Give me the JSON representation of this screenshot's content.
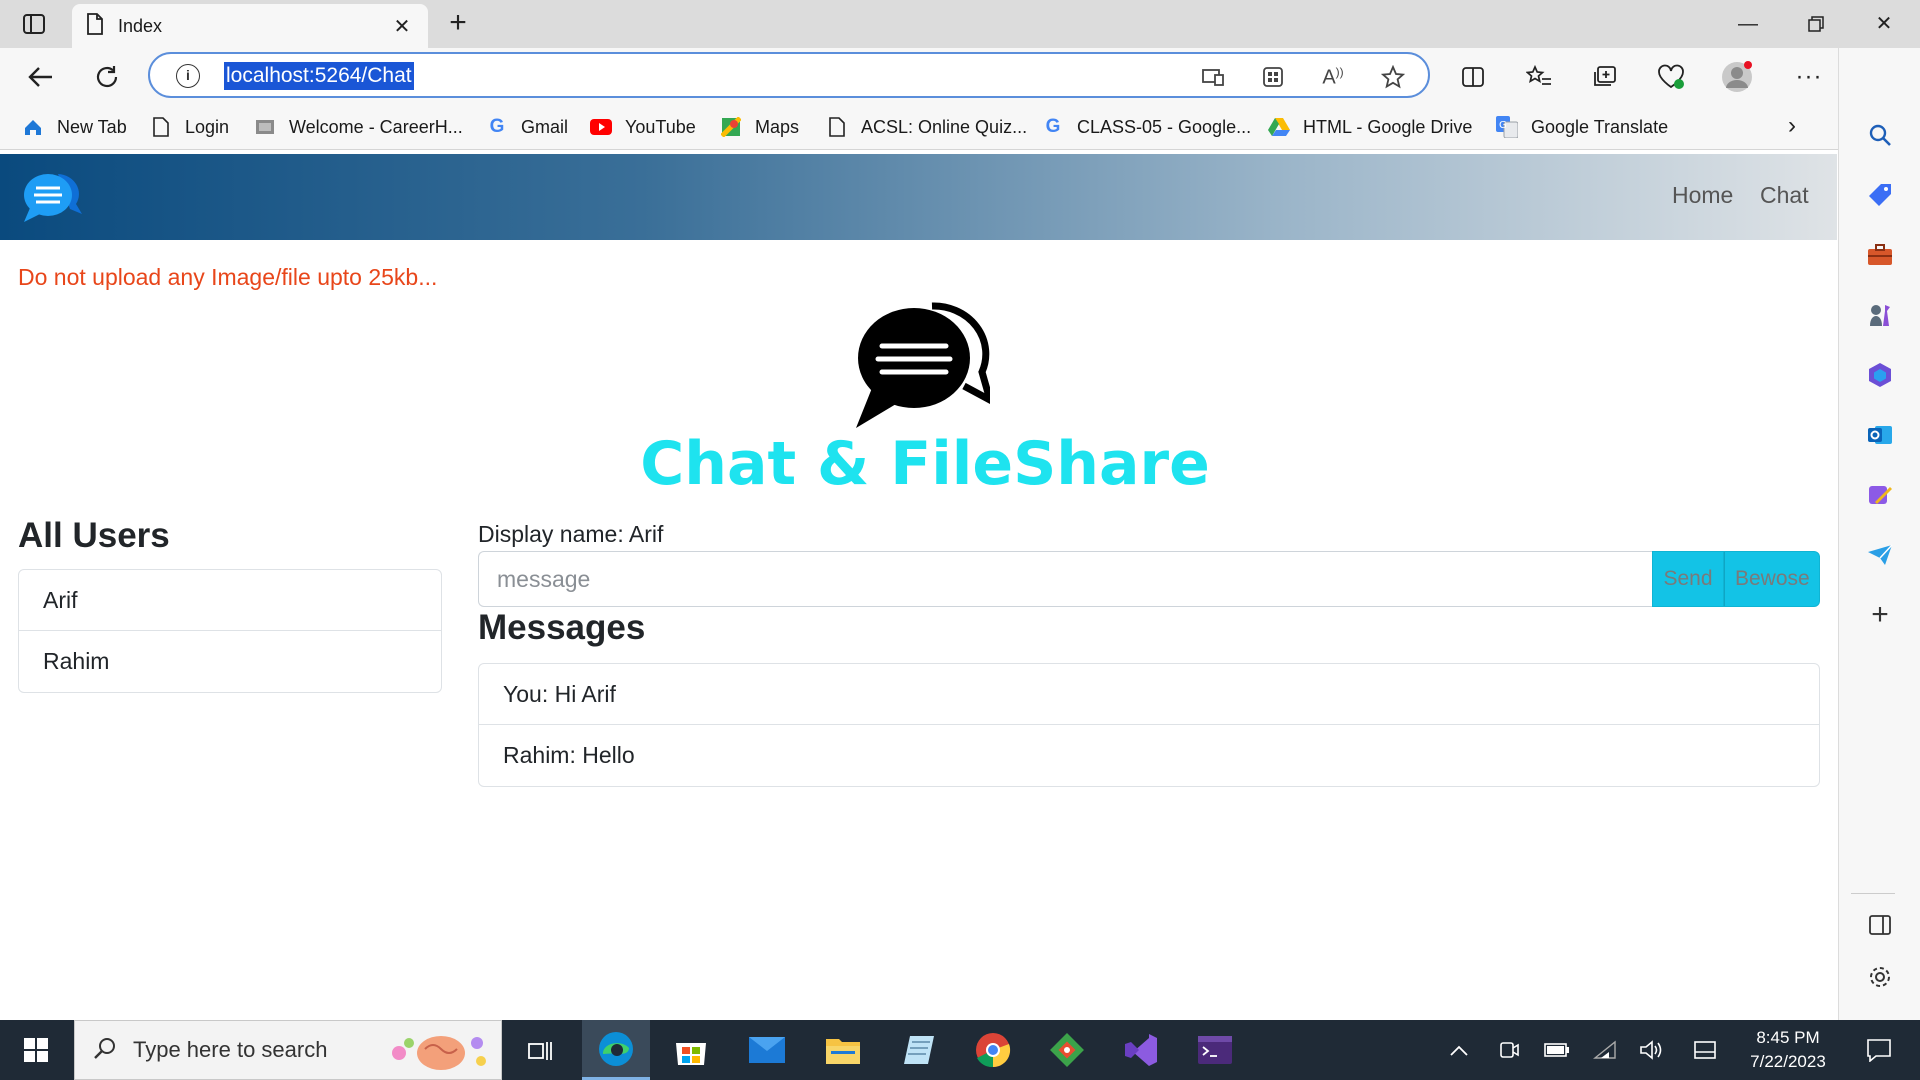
{
  "browser": {
    "tab_title": "Index",
    "url": "localhost:5264/Chat",
    "bookmarks": [
      {
        "label": "New Tab",
        "icon": "edge-icon"
      },
      {
        "label": "Login",
        "icon": "page-icon"
      },
      {
        "label": "Welcome - CareerH...",
        "icon": "careerhub-icon"
      },
      {
        "label": "Gmail",
        "icon": "google-icon"
      },
      {
        "label": "YouTube",
        "icon": "youtube-icon"
      },
      {
        "label": "Maps",
        "icon": "maps-icon"
      },
      {
        "label": "ACSL: Online Quiz...",
        "icon": "page-icon"
      },
      {
        "label": "CLASS-05 - Google...",
        "icon": "google-icon"
      },
      {
        "label": "HTML - Google Drive",
        "icon": "drive-icon"
      },
      {
        "label": "Google Translate",
        "icon": "translate-icon"
      }
    ]
  },
  "app": {
    "nav": {
      "home": "Home",
      "chat": "Chat"
    },
    "warning": "Do not upload any Image/file upto 25kb...",
    "title": "Chat & FileShare",
    "users_heading": "All Users",
    "users": [
      "Arif",
      "Rahim"
    ],
    "display_name": "Display name: Arif",
    "message_placeholder": "message",
    "send_label": "Send",
    "browse_label": "Bewose",
    "messages_heading": "Messages",
    "messages": [
      "You: Hi Arif",
      "Rahim: Hello"
    ]
  },
  "taskbar": {
    "search_placeholder": "Type here to search",
    "time": "8:45 PM",
    "date": "7/22/2023"
  },
  "colors": {
    "accent_cyan": "#1ee3ef",
    "warning_orange": "#e8461a",
    "button_cyan": "#13c3e6",
    "navbar_dark": "#0a4a7e"
  }
}
